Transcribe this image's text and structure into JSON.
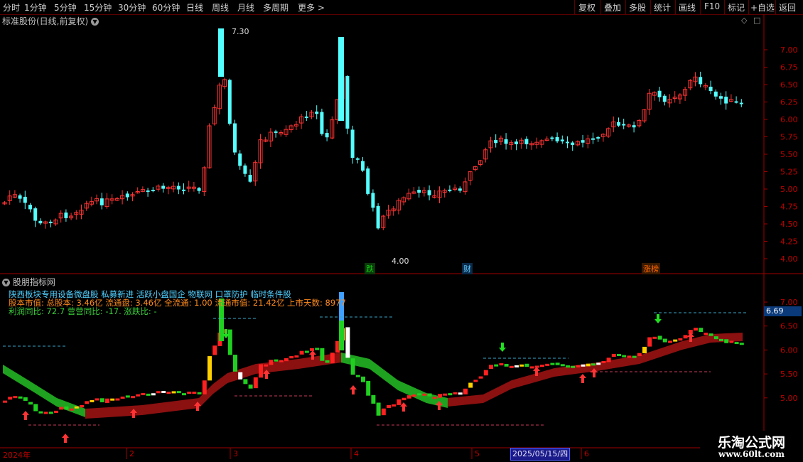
{
  "toolbar": {
    "periods": [
      "分时",
      "1分钟",
      "5分钟",
      "15分钟",
      "30分钟",
      "60分钟",
      "日线",
      "周线",
      "月线",
      "多周期",
      "更多 >"
    ],
    "right_buttons": [
      "复权",
      "叠加",
      "多股",
      "统计",
      "画线",
      "F10",
      "标记",
      "+自选",
      "返回"
    ]
  },
  "main_chart": {
    "title": "标准股份(日线,前复权)",
    "price_ticks": [
      "7.00",
      "6.75",
      "6.50",
      "6.25",
      "6.00",
      "5.75",
      "5.50",
      "5.25",
      "5.00",
      "4.75",
      "4.50",
      "4.25",
      "4.00"
    ],
    "high_label": "7.30",
    "low_label": "4.00",
    "event_markers": [
      "跌",
      "财",
      "涨榜"
    ]
  },
  "indicator": {
    "title": "股朋指标网",
    "line1": "陕西板块专用设备微盘股 私募新进 活跃小盘国企 物联网 口罩防护 临时条件股",
    "line2": "股本市值: 总股本: 3.46亿 流通盘: 3.46亿 全流通: 1.00 流通市值: 21.42亿 上市天数: 8977",
    "line3": "利润同比: 72.7 营营同比: -17.   涨跌比: -",
    "price_ticks": [
      "7.00",
      "6.50",
      "6.00",
      "5.50",
      "5.00"
    ],
    "current_price": "6.69"
  },
  "time_axis": {
    "labels": [
      "2024年",
      "2",
      "3",
      "4",
      "5",
      "6"
    ],
    "cursor_date": "2025/05/15/四"
  },
  "watermark": {
    "title": "乐淘公式网",
    "url": "www.60lt.com"
  },
  "colors": {
    "up": "#ff3333",
    "down": "#54ffff",
    "band_green": "#1fa21f",
    "band_red": "#8b1010",
    "axis_red": "#a00000"
  }
}
